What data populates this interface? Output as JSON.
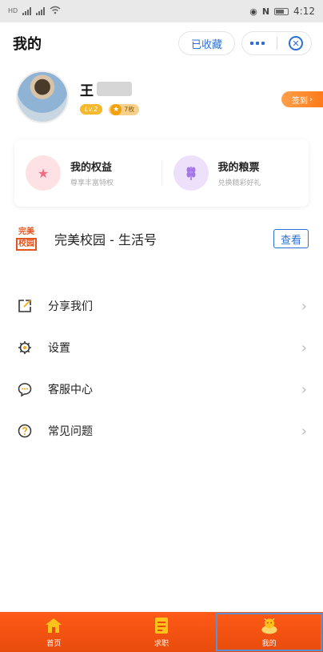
{
  "status_bar": {
    "time": "4:12",
    "carrier_tags": [
      "HD",
      "4G"
    ]
  },
  "header": {
    "title": "我的",
    "favorite_label": "已收藏"
  },
  "profile": {
    "name": "王",
    "level": "Lv.2",
    "coins": "7枚",
    "signin_label": "签到"
  },
  "benefits": [
    {
      "title": "我的权益",
      "subtitle": "尊享丰富特权",
      "icon": "crown-icon",
      "color": "#f36a84"
    },
    {
      "title": "我的粮票",
      "subtitle": "兑换精彩好礼",
      "icon": "wheat-icon",
      "color": "#a476e6"
    }
  ],
  "campus": {
    "logo_top": "完美",
    "logo_bottom": "校园",
    "name": "完美校园 - 生活号",
    "view_label": "查看"
  },
  "menu": [
    {
      "label": "分享我们",
      "icon": "share-icon"
    },
    {
      "label": "设置",
      "icon": "gear-icon"
    },
    {
      "label": "客服中心",
      "icon": "chat-icon"
    },
    {
      "label": "常见问题",
      "icon": "question-icon"
    }
  ],
  "tabbar": [
    {
      "label": "首页",
      "icon": "home-icon"
    },
    {
      "label": "求职",
      "icon": "resume-icon"
    },
    {
      "label": "我的",
      "icon": "profile-icon",
      "active": true
    }
  ],
  "colors": {
    "accent": "#2d6fd6",
    "brand": "#ff5a18"
  }
}
